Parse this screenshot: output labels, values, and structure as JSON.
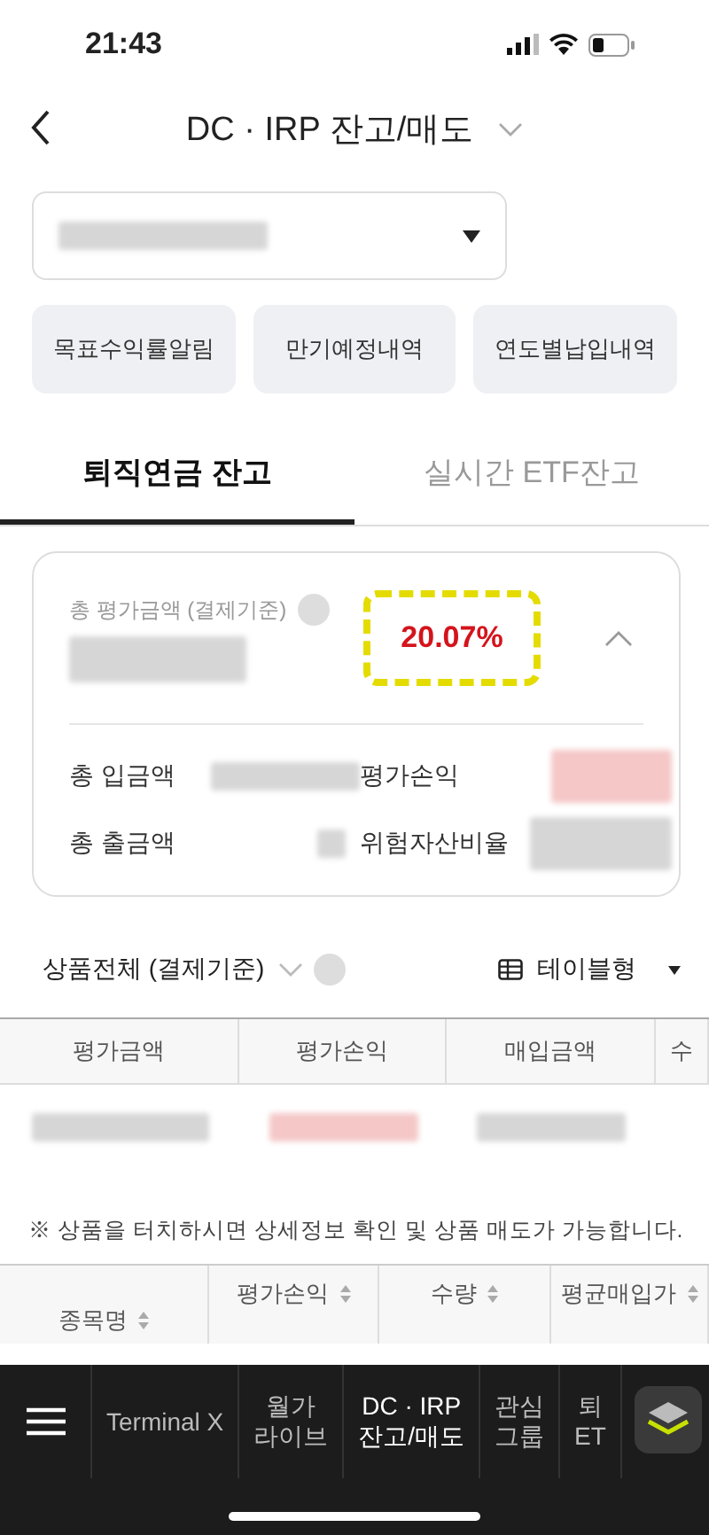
{
  "status_bar": {
    "time": "21:43"
  },
  "header": {
    "title": "DC · IRP 잔고/매도"
  },
  "quick_buttons": [
    "목표수익률알림",
    "만기예정내역",
    "연도별납입내역"
  ],
  "tabs": [
    {
      "label": "퇴직연금 잔고",
      "selected": true
    },
    {
      "label": "실시간 ETF잔고",
      "selected": false
    }
  ],
  "summary": {
    "total_label": "총 평가금액 (결제기준)",
    "return_rate": "20.07%",
    "expanded": true,
    "rows": [
      {
        "label": "총 입금액"
      },
      {
        "label": "평가손익"
      },
      {
        "label": "총 출금액"
      },
      {
        "label": "위험자산비율"
      }
    ]
  },
  "filter": {
    "label": "상품전체 (결제기준)",
    "view_label": "테이블형"
  },
  "table": {
    "columns": [
      "평가금액",
      "평가손익",
      "매입금액",
      "수"
    ]
  },
  "note": "※ 상품을 터치하시면 상세정보 확인 및 상품 매도가 가능합니다.",
  "table2": {
    "columns": [
      "종목명",
      "평가손익",
      "수량",
      "평균매입가"
    ]
  },
  "nav": [
    {
      "label": "Terminal X",
      "selected": false
    },
    {
      "label": "월가\n라이브",
      "selected": false
    },
    {
      "label": "DC · IRP\n잔고/매도",
      "selected": true
    },
    {
      "label": "관심\n그룹",
      "selected": false
    },
    {
      "label": "퇴\nET",
      "selected": false
    }
  ]
}
